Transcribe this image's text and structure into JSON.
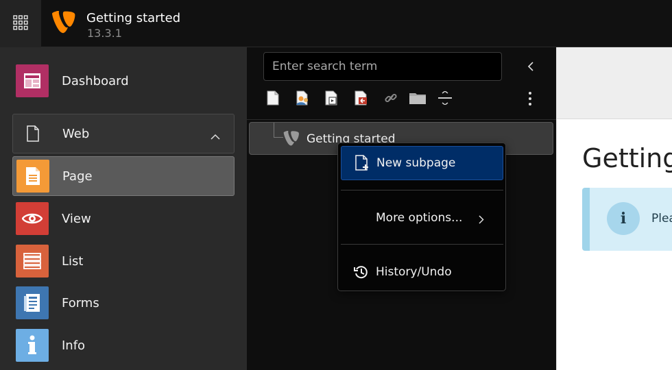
{
  "header": {
    "apps_icon": "grid-icon",
    "logo_icon": "typo3-logo-icon",
    "site_title": "Getting started",
    "site_version": "13.3.1",
    "brand_color": "#ff8700"
  },
  "modules": {
    "items": [
      {
        "label": "Dashboard",
        "icon": "dashboard-icon",
        "color": "#b12f64"
      },
      {
        "label": "Web",
        "icon": "file-icon",
        "expanded": true
      },
      {
        "label": "Page",
        "icon": "page-module-icon",
        "color": "#f49a37",
        "active": true
      },
      {
        "label": "View",
        "icon": "eye-icon",
        "color": "#d23e36"
      },
      {
        "label": "List",
        "icon": "list-icon",
        "color": "#d8623c"
      },
      {
        "label": "Forms",
        "icon": "forms-icon",
        "color": "#3e76b1"
      },
      {
        "label": "Info",
        "icon": "info-icon",
        "color": "#6daee4"
      }
    ]
  },
  "pagetree": {
    "search_placeholder": "Enter search term",
    "collapse_icon": "chevron-left-icon",
    "toolbar_icons": [
      "new-page-icon",
      "new-page-user-icon",
      "new-shortcut-icon",
      "new-external-link-icon",
      "link-icon",
      "folder-icon",
      "divider-icon"
    ],
    "more_icon": "kebab-icon",
    "root_node": {
      "label": "Getting started",
      "icon": "typo3-gray-icon"
    }
  },
  "context_menu": {
    "items": [
      {
        "label": "New subpage",
        "icon": "new-subpage-icon",
        "highlighted": true
      },
      {
        "label": "More options...",
        "icon": "",
        "has_submenu": true
      },
      {
        "label": "History/Undo",
        "icon": "history-icon"
      }
    ]
  },
  "content": {
    "title": "Getting",
    "callout_icon": "info-circle-icon",
    "callout_text": "Plea"
  }
}
